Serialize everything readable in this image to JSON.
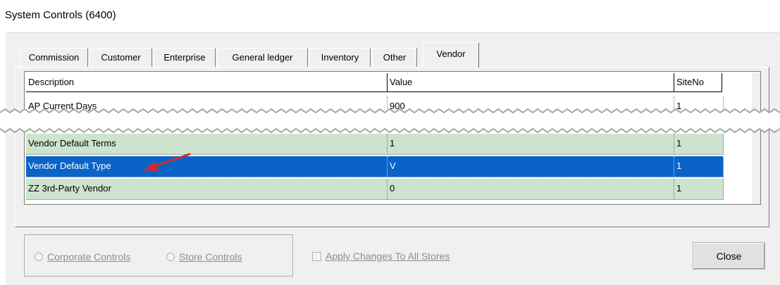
{
  "window": {
    "title": "System Controls (6400)"
  },
  "tabs": [
    {
      "label": "Commission"
    },
    {
      "label": "Customer"
    },
    {
      "label": "Enterprise"
    },
    {
      "label": "General ledger"
    },
    {
      "label": "Inventory"
    },
    {
      "label": "Other"
    },
    {
      "label": "Vendor"
    }
  ],
  "active_tab": "Vendor",
  "grid": {
    "columns": [
      "Description",
      "Value",
      "SiteNo"
    ],
    "rows": [
      {
        "description": "AP Current Days",
        "value": "900",
        "site": "1"
      },
      {
        "description": "Vendor Default Terms",
        "value": "1",
        "site": "1"
      },
      {
        "description": "Vendor Default Type",
        "value": "V",
        "site": "1"
      },
      {
        "description": "ZZ 3rd-Party Vendor",
        "value": "0",
        "site": "1"
      }
    ]
  },
  "controls": {
    "corporate_label": "Corporate Controls",
    "store_label": "Store Controls",
    "apply_label": "Apply Changes To All Stores",
    "close_label": "Close"
  },
  "icons": {
    "scroll_up": "chevron-up-icon",
    "scroll_down": "chevron-down-icon",
    "annotation": "red-arrow-icon"
  },
  "colors": {
    "selection": "#0a64c8",
    "row_highlight": "#cde3cd",
    "annotation": "#d9262c"
  }
}
